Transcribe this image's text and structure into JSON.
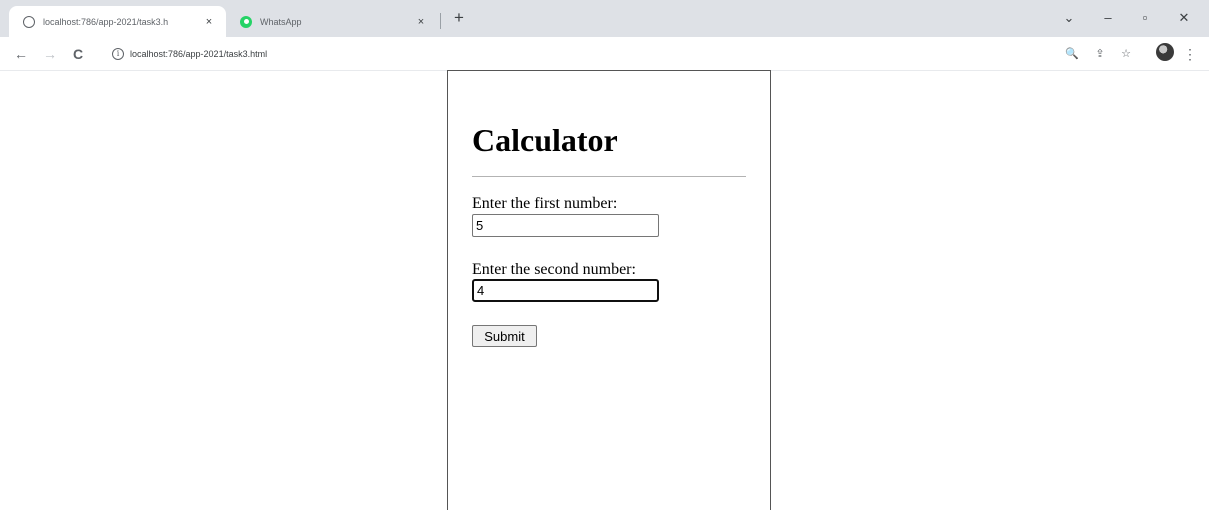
{
  "browser": {
    "tabs": [
      {
        "title": "localhost:786/app-2021/task3.h",
        "close": "×",
        "icon": "globe-icon",
        "active": true
      },
      {
        "title": "WhatsApp",
        "close": "×",
        "icon": "whatsapp-icon",
        "active": false
      }
    ],
    "new_tab": "+",
    "window_controls": {
      "tab_search": "⌄",
      "minimize": "–",
      "restore": "▫",
      "close": "✕"
    },
    "nav": {
      "back": "←",
      "forward": "→",
      "reload": "C"
    },
    "address": "localhost:786/app-2021/task3.html",
    "site_info_glyph": "i",
    "toolbar_icons": {
      "zoom": "🔍",
      "share": "⇪",
      "bookmark": "☆",
      "menu": "⋮"
    }
  },
  "page": {
    "heading": "Calculator",
    "first_label": "Enter the first number:",
    "first_value": "5",
    "second_label": "Enter the second number:",
    "second_value": "4",
    "submit_label": "Submit"
  }
}
